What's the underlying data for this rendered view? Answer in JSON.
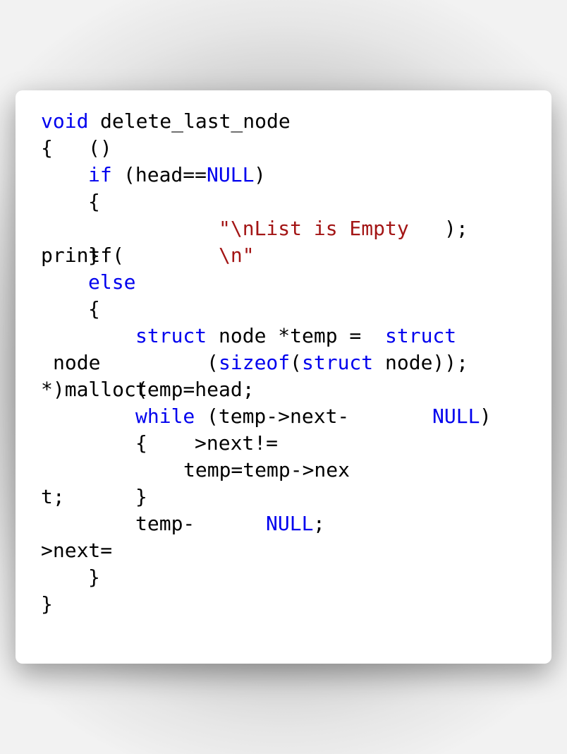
{
  "colors": {
    "keyword": "#0000ee",
    "string": "#a31515",
    "text": "#000000",
    "card": "#ffffff"
  },
  "code": {
    "void": "void",
    "fn_name": "delete_last_node",
    "open_brace_1": "{",
    "parens": "()",
    "if": "if",
    "head_cond": "(head==",
    "null_1": "NULL",
    "close_paren_1": ")",
    "open_brace_2": "{",
    "str_1": "\"\\nList is Empty",
    "str_close": ");",
    "printf": "printf(",
    "close_brace_1": "}",
    "str_2": "\\n\"",
    "else": "else",
    "open_brace_3": "{",
    "struct_1": "struct",
    "node_temp": "node *temp =",
    "struct_2": "struct",
    "node_word": "node",
    "paren_open": "(",
    "sizeof": "sizeof",
    "paren_open_2": "(",
    "struct_3": "struct",
    "node_close": "node));",
    "malloc": "*)malloc(",
    "temp_head": "temp=head;",
    "while": "while",
    "while_cond": "(temp->next-",
    "null_2": "NULL",
    "close_paren_2": ")",
    "open_brace_4": "{",
    "next_neq": ">next!=",
    "temp_assign": "temp=temp->nex",
    "t_semi": "t;",
    "close_brace_2": "}",
    "temp_dash": "temp-",
    "null_3": "NULL",
    "semi": ";",
    "next_eq": ">next=",
    "close_brace_3": "}",
    "close_brace_4": "}"
  }
}
